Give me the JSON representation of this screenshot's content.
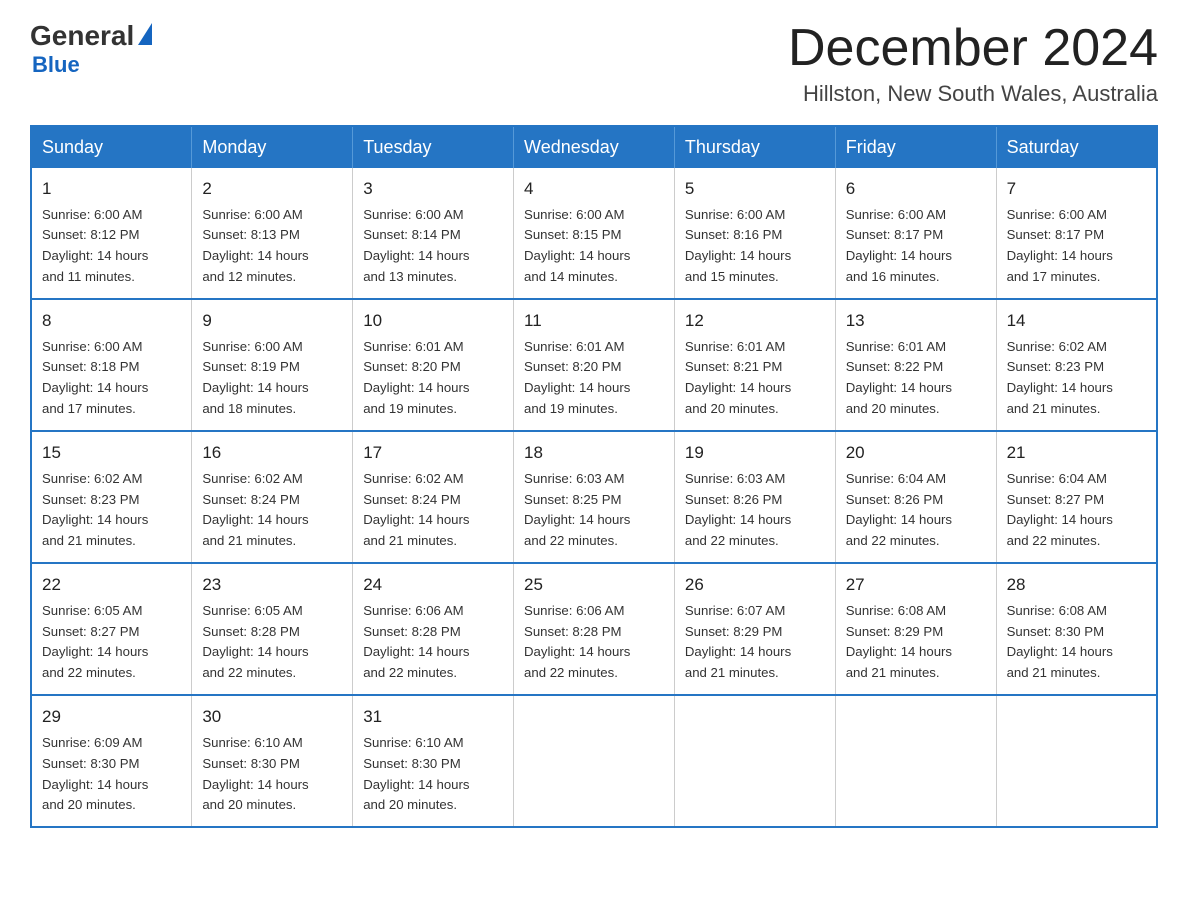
{
  "header": {
    "logo_general": "General",
    "logo_blue": "Blue",
    "month_title": "December 2024",
    "location": "Hillston, New South Wales, Australia"
  },
  "days_of_week": [
    "Sunday",
    "Monday",
    "Tuesday",
    "Wednesday",
    "Thursday",
    "Friday",
    "Saturday"
  ],
  "weeks": [
    [
      {
        "day": "1",
        "sunrise": "6:00 AM",
        "sunset": "8:12 PM",
        "daylight": "14 hours and 11 minutes."
      },
      {
        "day": "2",
        "sunrise": "6:00 AM",
        "sunset": "8:13 PM",
        "daylight": "14 hours and 12 minutes."
      },
      {
        "day": "3",
        "sunrise": "6:00 AM",
        "sunset": "8:14 PM",
        "daylight": "14 hours and 13 minutes."
      },
      {
        "day": "4",
        "sunrise": "6:00 AM",
        "sunset": "8:15 PM",
        "daylight": "14 hours and 14 minutes."
      },
      {
        "day": "5",
        "sunrise": "6:00 AM",
        "sunset": "8:16 PM",
        "daylight": "14 hours and 15 minutes."
      },
      {
        "day": "6",
        "sunrise": "6:00 AM",
        "sunset": "8:17 PM",
        "daylight": "14 hours and 16 minutes."
      },
      {
        "day": "7",
        "sunrise": "6:00 AM",
        "sunset": "8:17 PM",
        "daylight": "14 hours and 17 minutes."
      }
    ],
    [
      {
        "day": "8",
        "sunrise": "6:00 AM",
        "sunset": "8:18 PM",
        "daylight": "14 hours and 17 minutes."
      },
      {
        "day": "9",
        "sunrise": "6:00 AM",
        "sunset": "8:19 PM",
        "daylight": "14 hours and 18 minutes."
      },
      {
        "day": "10",
        "sunrise": "6:01 AM",
        "sunset": "8:20 PM",
        "daylight": "14 hours and 19 minutes."
      },
      {
        "day": "11",
        "sunrise": "6:01 AM",
        "sunset": "8:20 PM",
        "daylight": "14 hours and 19 minutes."
      },
      {
        "day": "12",
        "sunrise": "6:01 AM",
        "sunset": "8:21 PM",
        "daylight": "14 hours and 20 minutes."
      },
      {
        "day": "13",
        "sunrise": "6:01 AM",
        "sunset": "8:22 PM",
        "daylight": "14 hours and 20 minutes."
      },
      {
        "day": "14",
        "sunrise": "6:02 AM",
        "sunset": "8:23 PM",
        "daylight": "14 hours and 21 minutes."
      }
    ],
    [
      {
        "day": "15",
        "sunrise": "6:02 AM",
        "sunset": "8:23 PM",
        "daylight": "14 hours and 21 minutes."
      },
      {
        "day": "16",
        "sunrise": "6:02 AM",
        "sunset": "8:24 PM",
        "daylight": "14 hours and 21 minutes."
      },
      {
        "day": "17",
        "sunrise": "6:02 AM",
        "sunset": "8:24 PM",
        "daylight": "14 hours and 21 minutes."
      },
      {
        "day": "18",
        "sunrise": "6:03 AM",
        "sunset": "8:25 PM",
        "daylight": "14 hours and 22 minutes."
      },
      {
        "day": "19",
        "sunrise": "6:03 AM",
        "sunset": "8:26 PM",
        "daylight": "14 hours and 22 minutes."
      },
      {
        "day": "20",
        "sunrise": "6:04 AM",
        "sunset": "8:26 PM",
        "daylight": "14 hours and 22 minutes."
      },
      {
        "day": "21",
        "sunrise": "6:04 AM",
        "sunset": "8:27 PM",
        "daylight": "14 hours and 22 minutes."
      }
    ],
    [
      {
        "day": "22",
        "sunrise": "6:05 AM",
        "sunset": "8:27 PM",
        "daylight": "14 hours and 22 minutes."
      },
      {
        "day": "23",
        "sunrise": "6:05 AM",
        "sunset": "8:28 PM",
        "daylight": "14 hours and 22 minutes."
      },
      {
        "day": "24",
        "sunrise": "6:06 AM",
        "sunset": "8:28 PM",
        "daylight": "14 hours and 22 minutes."
      },
      {
        "day": "25",
        "sunrise": "6:06 AM",
        "sunset": "8:28 PM",
        "daylight": "14 hours and 22 minutes."
      },
      {
        "day": "26",
        "sunrise": "6:07 AM",
        "sunset": "8:29 PM",
        "daylight": "14 hours and 21 minutes."
      },
      {
        "day": "27",
        "sunrise": "6:08 AM",
        "sunset": "8:29 PM",
        "daylight": "14 hours and 21 minutes."
      },
      {
        "day": "28",
        "sunrise": "6:08 AM",
        "sunset": "8:30 PM",
        "daylight": "14 hours and 21 minutes."
      }
    ],
    [
      {
        "day": "29",
        "sunrise": "6:09 AM",
        "sunset": "8:30 PM",
        "daylight": "14 hours and 20 minutes."
      },
      {
        "day": "30",
        "sunrise": "6:10 AM",
        "sunset": "8:30 PM",
        "daylight": "14 hours and 20 minutes."
      },
      {
        "day": "31",
        "sunrise": "6:10 AM",
        "sunset": "8:30 PM",
        "daylight": "14 hours and 20 minutes."
      },
      null,
      null,
      null,
      null
    ]
  ],
  "labels": {
    "sunrise": "Sunrise:",
    "sunset": "Sunset:",
    "daylight": "Daylight:"
  }
}
